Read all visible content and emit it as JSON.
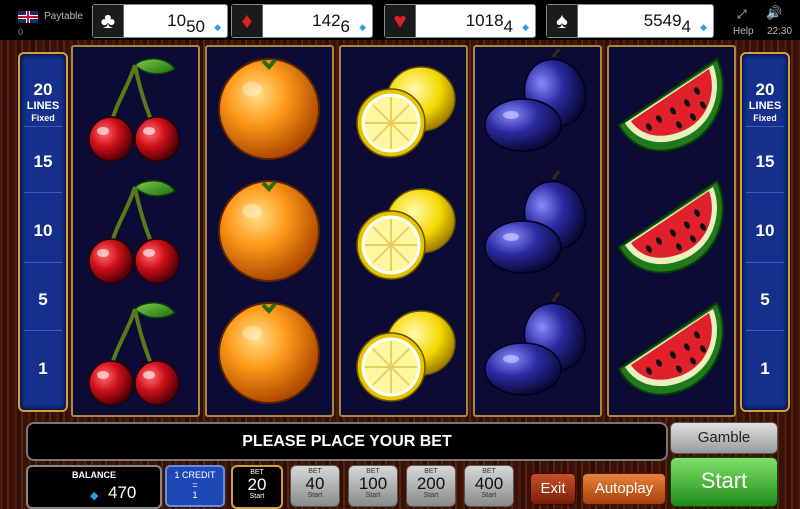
{
  "topbar": {
    "paytable_label": "Paytable",
    "zero_label": "0",
    "help_label": "Help",
    "clock": "22:30",
    "jackpots": [
      {
        "suit": "clubs",
        "symbol": "♣",
        "main": "10",
        "sub": "50"
      },
      {
        "suit": "diamonds",
        "symbol": "♦",
        "main": "142",
        "sub": "6"
      },
      {
        "suit": "hearts",
        "symbol": "♥",
        "main": "1018",
        "sub": "4"
      },
      {
        "suit": "spades",
        "symbol": "♠",
        "main": "5549",
        "sub": "4"
      }
    ]
  },
  "lines_panel": {
    "count": "20",
    "label": "LINES",
    "fixed": "Fixed",
    "markers": [
      "15",
      "10",
      "5",
      "1"
    ]
  },
  "reels": [
    {
      "symbol": "cherry-icon"
    },
    {
      "symbol": "orange-icon"
    },
    {
      "symbol": "lemon-icon"
    },
    {
      "symbol": "plum-icon"
    },
    {
      "symbol": "watermelon-icon"
    }
  ],
  "message": "PLEASE PLACE YOUR BET",
  "gamble_label": "Gamble",
  "balance": {
    "title": "BALANCE",
    "value": "470"
  },
  "credit": {
    "title": "1 CREDIT",
    "eq": "=",
    "value": "1"
  },
  "bets": [
    {
      "label": "BET",
      "value": "20",
      "sub": "Start",
      "selected": true
    },
    {
      "label": "BET",
      "value": "40",
      "sub": "Start"
    },
    {
      "label": "BET",
      "value": "100",
      "sub": "Start"
    },
    {
      "label": "BET",
      "value": "200",
      "sub": "Start"
    },
    {
      "label": "BET",
      "value": "400",
      "sub": "Start"
    }
  ],
  "exit_label": "Exit",
  "autoplay_label": "Autoplay",
  "start_label": "Start"
}
